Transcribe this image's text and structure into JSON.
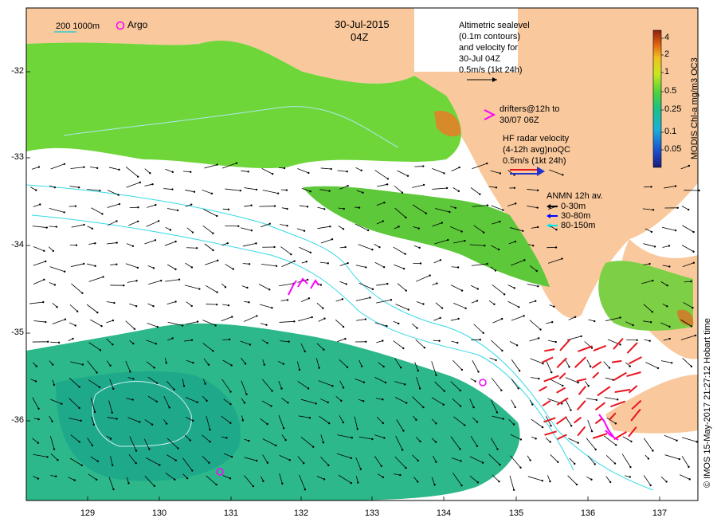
{
  "map": {
    "date": "30-Jul-2015",
    "time": "04Z",
    "scale_bar": "200  1000m",
    "argo_label": "Argo",
    "altimetry_text": [
      "Altimetric sealevel",
      "(0.1m contours)",
      "and velocity for",
      "30-Jul 04Z",
      "0.5m/s (1kt 24h)"
    ],
    "drifters_text": [
      "drifters@12h to",
      "30/07 06Z"
    ],
    "hf_radar_text": [
      "HF radar velocity",
      "(4-12h avg)noQC",
      "0.5m/s (1kt 24h)"
    ],
    "anmn_title": "ANMN 12h av.",
    "anmn_items": [
      {
        "label": "0-30m",
        "color": "#000000"
      },
      {
        "label": "30-80m",
        "color": "#0000ff"
      },
      {
        "label": "80-150m",
        "color": "#00e5ee"
      }
    ],
    "colorbar_title": "MODIS Chl-a mg/m3 OC3",
    "colorbar_ticks": [
      "4",
      "2",
      "1",
      "0.5",
      "0.25",
      "0.1",
      "0.05"
    ],
    "credit": "© IMOS 15-May-2017 21:27:12 Hobart time",
    "lat_labels": [
      "-32",
      "-33",
      "-34",
      "-35",
      "-36"
    ],
    "lon_labels": [
      "129",
      "130",
      "131",
      "132",
      "133",
      "134",
      "135",
      "136",
      "137"
    ],
    "colors": {
      "land": "#f9c89c",
      "drifter": "#ff00ff",
      "hf_radar": "#e8141e",
      "contour": "#33d9e6",
      "legend_cyan": "#33cccc"
    }
  }
}
